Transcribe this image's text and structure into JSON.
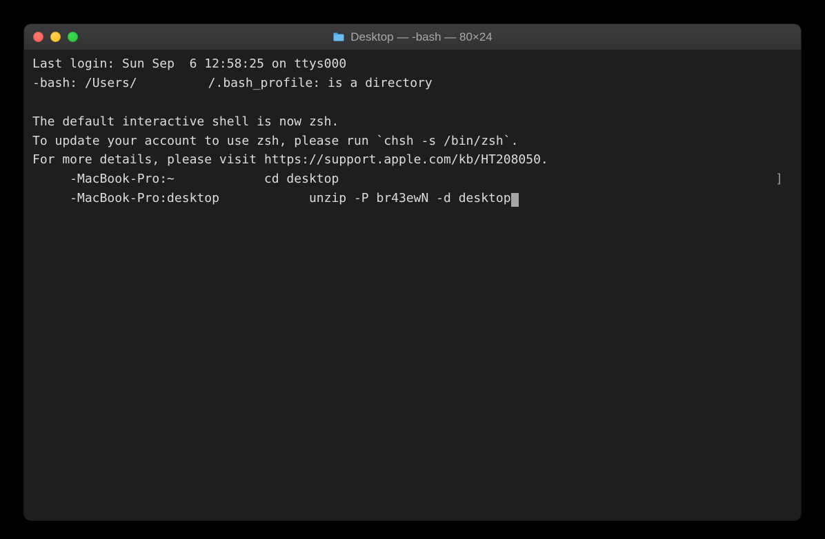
{
  "titlebar": {
    "title": "Desktop — -bash — 80×24"
  },
  "lines": {
    "l1_login": "Last login: Sun Sep  6 12:58:25 on ttys000",
    "l2_a": "-bash: /Users/",
    "l2_b": "/.bash_profile: is a directory",
    "l3_blank": "",
    "l4": "The default interactive shell is now zsh.",
    "l5": "To update your account to use zsh, please run `chsh -s /bin/zsh`.",
    "l6": "For more details, please visit https://support.apple.com/kb/HT208050.",
    "l7_prompt": "-MacBook-Pro:~",
    "l7_cmd": "cd desktop",
    "l7_tail": "]",
    "l8_prompt": "-MacBook-Pro:desktop",
    "l8_cmd": "unzip -P br43ewN -d desktop"
  }
}
